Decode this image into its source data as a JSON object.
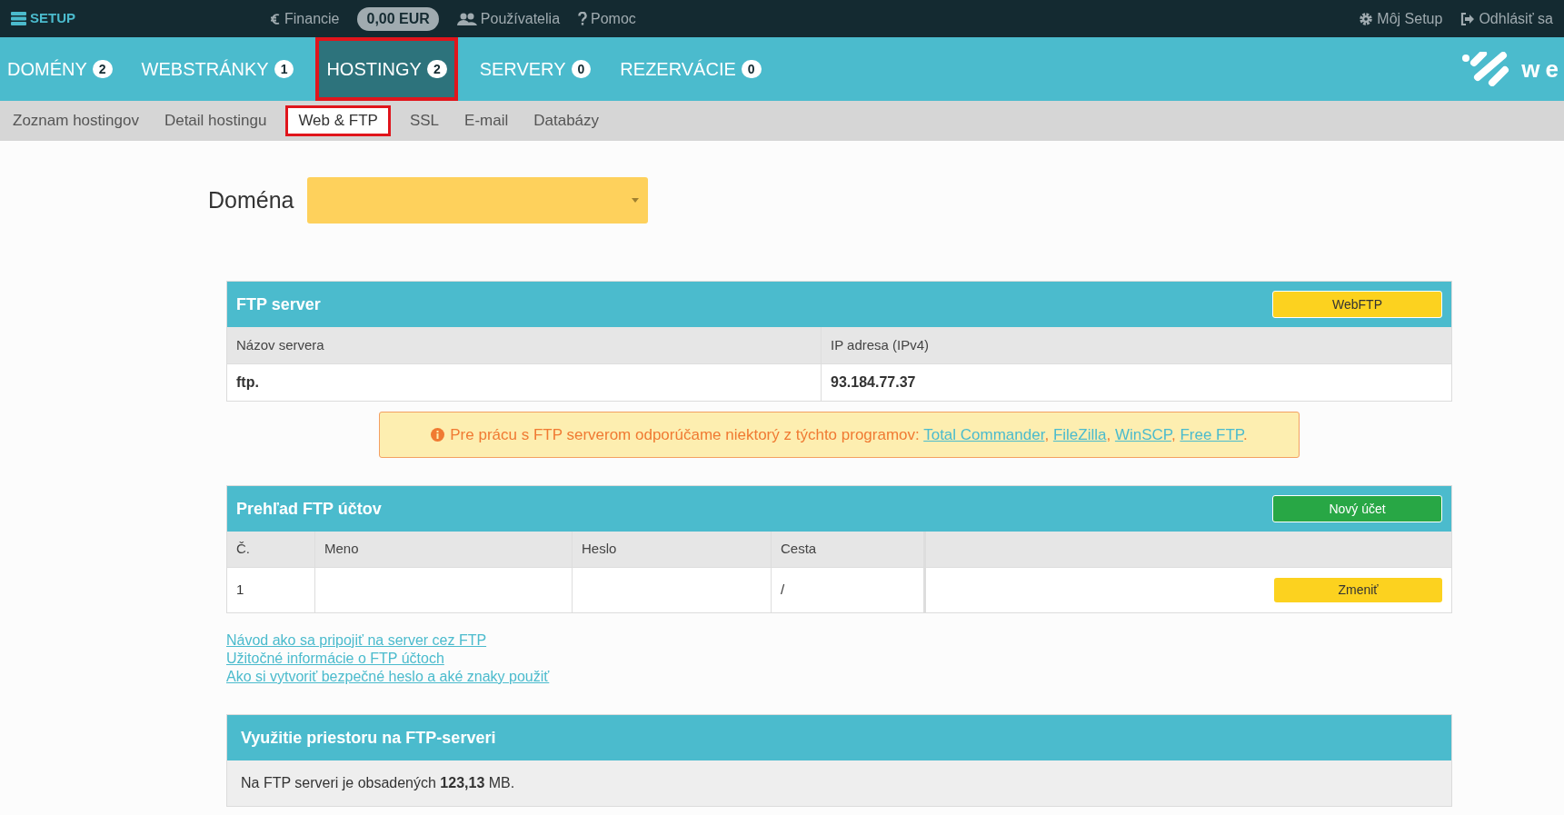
{
  "top_bar": {
    "brand": "SETUP",
    "items": [
      {
        "kind": "link",
        "label": "Financie"
      },
      {
        "kind": "pill",
        "label": "0,00 EUR"
      },
      {
        "kind": "link",
        "label": "Používatelia"
      },
      {
        "kind": "link",
        "label": "Pomoc"
      }
    ],
    "right_items": [
      {
        "label": "Môj Setup"
      },
      {
        "label": "Odhlásiť sa"
      }
    ]
  },
  "main_tabs": [
    {
      "label": "DOMÉNY",
      "count": "2",
      "selected": false
    },
    {
      "label": "WEBSTRÁNKY",
      "count": "1",
      "selected": false
    },
    {
      "label": "HOSTINGY",
      "count": "2",
      "selected": true
    },
    {
      "label": "SERVERY",
      "count": "0",
      "selected": false
    },
    {
      "label": "REZERVÁCIE",
      "count": "0",
      "selected": false
    }
  ],
  "logo_text": "we",
  "sub_tabs": [
    {
      "label": "Zoznam hostingov",
      "selected": false
    },
    {
      "label": "Detail hostingu",
      "selected": false
    },
    {
      "label": "Web & FTP",
      "selected": true
    },
    {
      "label": "SSL",
      "selected": false
    },
    {
      "label": "E-mail",
      "selected": false
    },
    {
      "label": "Databázy",
      "selected": false
    }
  ],
  "domain": {
    "label": "Doména"
  },
  "ftp_server": {
    "title": "FTP server",
    "button": "WebFTP",
    "columns": [
      "Názov servera",
      "IP adresa (IPv4)"
    ],
    "values": [
      "ftp.",
      "93.184.77.37"
    ]
  },
  "alert": {
    "parts": [
      {
        "kind": "text",
        "text": "Pre prácu s FTP serverom odporúčame niektorý z týchto programov: "
      },
      {
        "kind": "link",
        "text": "Total Commander"
      },
      {
        "kind": "text",
        "text": ", "
      },
      {
        "kind": "link",
        "text": "FileZilla"
      },
      {
        "kind": "text",
        "text": ", "
      },
      {
        "kind": "link",
        "text": "WinSCP"
      },
      {
        "kind": "text",
        "text": ", "
      },
      {
        "kind": "link",
        "text": "Free FTP"
      },
      {
        "kind": "text",
        "text": "."
      }
    ]
  },
  "accounts": {
    "title": "Prehľad FTP účtov",
    "button": "Nový účet",
    "columns": [
      "Č.",
      "Meno",
      "Heslo",
      "Cesta"
    ],
    "rows": [
      {
        "cells": [
          "1",
          "",
          "",
          "/"
        ],
        "action": "Zmeniť"
      }
    ]
  },
  "help_links": [
    "Návod ako sa pripojiť na server cez FTP",
    "Užitočné informácie o FTP účtoch",
    "Ako si vytvoriť bezpečné heslo a aké znaky použiť"
  ],
  "usage": {
    "title": "Využitie priestoru na FTP-serveri",
    "text": "Na FTP serveri je obsadených **123,13** MB."
  }
}
